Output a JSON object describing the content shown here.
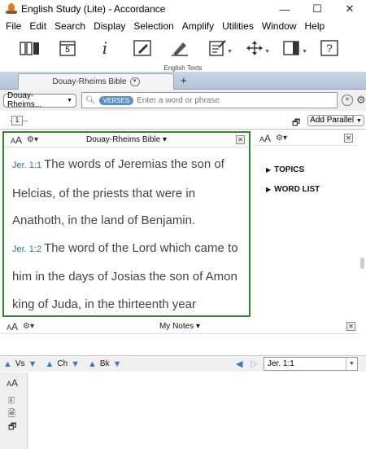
{
  "window": {
    "title": "English Study (Lite) - Accordance",
    "minimize": "—",
    "maximize": "☐",
    "close": "✕"
  },
  "menu": [
    "File",
    "Edit",
    "Search",
    "Display",
    "Selection",
    "Amplify",
    "Utilities",
    "Window",
    "Help"
  ],
  "toolbar": {
    "calendar_day": "5",
    "info_glyph": "i",
    "help_glyph": "?"
  },
  "workspace": {
    "label": "English Texts",
    "tab_label": "Douay-Rheims Bible",
    "add_tab": "+"
  },
  "search": {
    "text_select": "Douay-Rheims...",
    "mode": "VERSES",
    "placeholder": "Enter a word or phrase"
  },
  "slider": {
    "value": "1"
  },
  "parallel": {
    "button_label": "Add Parallel"
  },
  "bible_pane": {
    "title": "Douay-Rheims Bible",
    "verses": [
      {
        "ref": "Jer. 1:1",
        "text": "The words of Jeremias the son of Helcias, of the priests that were in Anathoth, in the land of Benjamin."
      },
      {
        "ref": "Jer. 1:2",
        "text": "The word of the Lord which came to him in the days of Josias the son of Amon king of Juda, in the thirteenth year"
      }
    ]
  },
  "right_pane": {
    "sections": [
      "TOPICS",
      "WORD LIST"
    ]
  },
  "notes_pane": {
    "title": "My Notes"
  },
  "navigation": {
    "vs": "Vs",
    "ch": "Ch",
    "bk": "Bk",
    "reference": "Jer. 1:1"
  },
  "colors": {
    "accent_green": "#2f8a2f",
    "reference_blue": "#2d6ea8",
    "tab_strip": "#c9d6e6"
  }
}
